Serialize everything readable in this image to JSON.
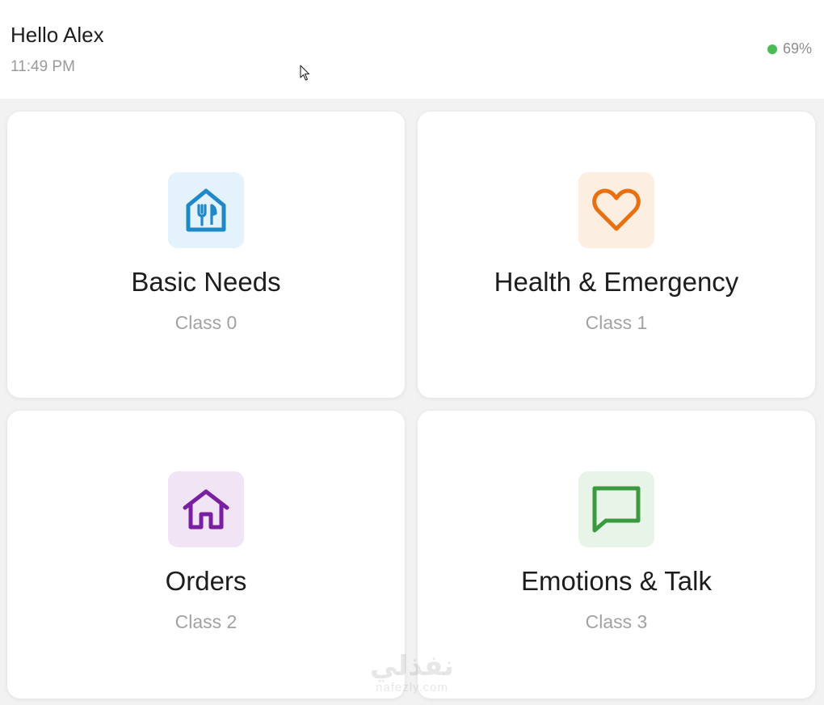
{
  "header": {
    "greeting": "Hello Alex",
    "time": "11:49 PM",
    "battery": "69%",
    "battery_color": "#4cbb55"
  },
  "cards": [
    {
      "title": "Basic Needs",
      "subtitle": "Class 0",
      "icon": "house-utensils-icon",
      "accent": "#1e88c9",
      "tile": "#e3f2fb"
    },
    {
      "title": "Health & Emergency",
      "subtitle": "Class 1",
      "icon": "heart-icon",
      "accent": "#e8700f",
      "tile": "#fdeee2"
    },
    {
      "title": "Orders",
      "subtitle": "Class 2",
      "icon": "home-icon",
      "accent": "#7a1fa2",
      "tile": "#f1e4f5"
    },
    {
      "title": "Emotions & Talk",
      "subtitle": "Class 3",
      "icon": "chat-bubble-icon",
      "accent": "#3b9a3f",
      "tile": "#e8f4e8"
    }
  ],
  "watermark": {
    "logo": "نفذلي",
    "site": "nafezly.com"
  }
}
